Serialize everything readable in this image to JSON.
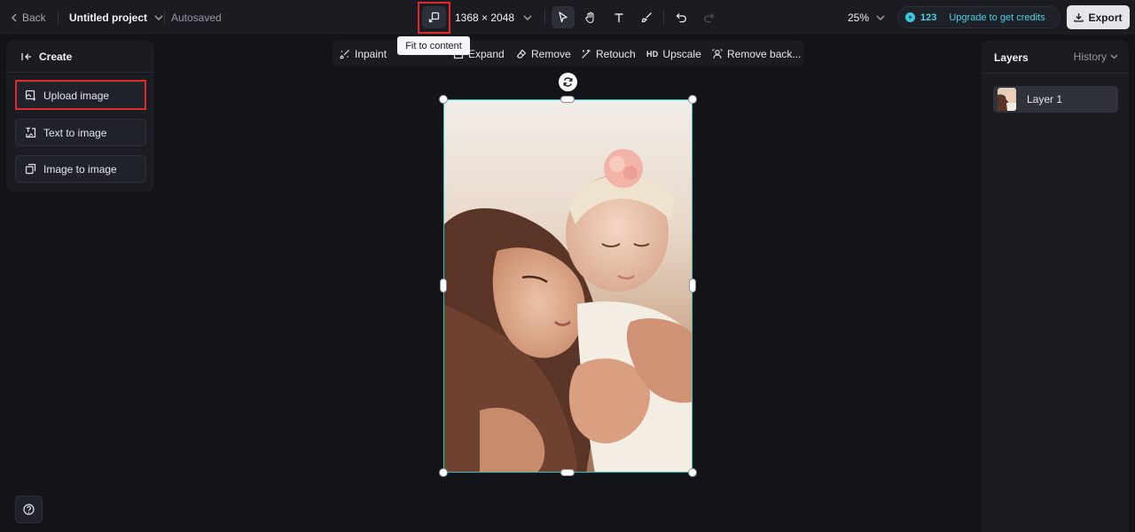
{
  "topbar": {
    "back_label": "Back",
    "project_title": "Untitled project",
    "autosaved": "Autosaved",
    "canvas_size": "1368 × 2048",
    "zoom": "25%",
    "credits_count": "123",
    "upgrade_label": "Upgrade to get credits",
    "export_label": "Export"
  },
  "tooltip": "Fit to content",
  "left_panel": {
    "title": "Create",
    "items": [
      {
        "label": "Upload image"
      },
      {
        "label": "Text to image"
      },
      {
        "label": "Image to image"
      }
    ]
  },
  "canvas_toolbar": {
    "items": [
      {
        "label": "Inpaint",
        "icon": "inpaint-icon"
      },
      {
        "label": "Expand",
        "icon": "expand-icon"
      },
      {
        "label": "Remove",
        "icon": "eraser-icon"
      },
      {
        "label": "Retouch",
        "icon": "retouch-icon"
      },
      {
        "label": "Upscale",
        "icon": "hd-icon",
        "badge": "HD"
      },
      {
        "label": "Remove back...",
        "icon": "remove-background-icon"
      }
    ]
  },
  "right_panel": {
    "tab_layers": "Layers",
    "tab_history": "History",
    "layers": [
      {
        "name": "Layer 1"
      }
    ]
  },
  "colors": {
    "background": "#121419",
    "panel": "#1a1c22",
    "accent": "#4ad4e6",
    "selection": "#2ec7c0",
    "highlight_box": "#e0282e"
  }
}
